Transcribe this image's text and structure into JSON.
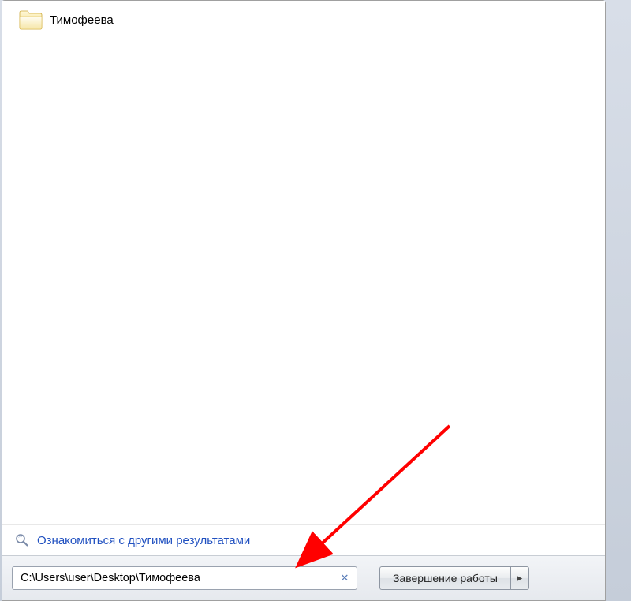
{
  "result": {
    "label": "Тимофеева",
    "icon": "folder-icon"
  },
  "moreResults": {
    "icon": "magnifier-icon",
    "label": "Ознакомиться с другими результатами"
  },
  "search": {
    "value": "C:\\Users\\user\\Desktop\\Тимофеева",
    "clearSymbol": "✕"
  },
  "shutdown": {
    "label": "Завершение работы",
    "arrow": "▸"
  }
}
